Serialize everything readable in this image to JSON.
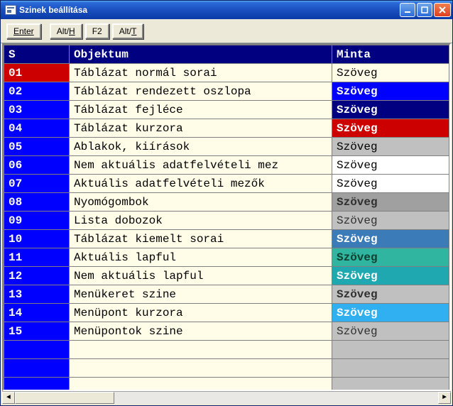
{
  "window": {
    "title": "Szinek beállítása"
  },
  "toolbar": {
    "enter": "Enter",
    "alth_pre": "Alt/",
    "alth_ul": "H",
    "f2": "F2",
    "altt_pre": "Alt/",
    "altt_ul": "T"
  },
  "columns": {
    "s": "S",
    "objektum": "Objektum",
    "minta": "Minta"
  },
  "rows": [
    {
      "s": "01",
      "obj": "Táblázat normál sorai",
      "minta": "Szöveg",
      "bg": "#fffde8",
      "fg": "#000000",
      "bold": false,
      "sel": true
    },
    {
      "s": "02",
      "obj": "Táblázat rendezett oszlopa",
      "minta": "Szöveg",
      "bg": "#0000ff",
      "fg": "#ffffff",
      "bold": true
    },
    {
      "s": "03",
      "obj": "Táblázat fejléce",
      "minta": "Szöveg",
      "bg": "#000080",
      "fg": "#ffffff",
      "bold": true
    },
    {
      "s": "04",
      "obj": "Táblázat kurzora",
      "minta": "Szöveg",
      "bg": "#cc0000",
      "fg": "#ffffff",
      "bold": true
    },
    {
      "s": "05",
      "obj": "Ablakok, kiírások",
      "minta": "Szöveg",
      "bg": "#c0c0c0",
      "fg": "#000000",
      "bold": false
    },
    {
      "s": "06",
      "obj": "Nem aktuális adatfelvételi mez",
      "minta": "Szöveg",
      "bg": "#ffffff",
      "fg": "#000000",
      "bold": false
    },
    {
      "s": "07",
      "obj": "Aktuális adatfelvételi mezők",
      "minta": "Szöveg",
      "bg": "#ffffff",
      "fg": "#000000",
      "bold": false
    },
    {
      "s": "08",
      "obj": "Nyomógombok",
      "minta": "Szöveg",
      "bg": "#a0a0a0",
      "fg": "#303030",
      "bold": true
    },
    {
      "s": "09",
      "obj": "Lista dobozok",
      "minta": "Szöveg",
      "bg": "#c0c0c0",
      "fg": "#303030",
      "bold": false
    },
    {
      "s": "10",
      "obj": "Táblázat kiemelt sorai",
      "minta": "Szöveg",
      "bg": "#3b7cb8",
      "fg": "#ffffff",
      "bold": true
    },
    {
      "s": "11",
      "obj": "Aktuális lapful",
      "minta": "Szöveg",
      "bg": "#2fb5a0",
      "fg": "#104030",
      "bold": true
    },
    {
      "s": "12",
      "obj": "Nem aktuális lapful",
      "minta": "Szöveg",
      "bg": "#20a8b0",
      "fg": "#ffffff",
      "bold": true
    },
    {
      "s": "13",
      "obj": "Menükeret szine",
      "minta": "Szöveg",
      "bg": "#c0c0c0",
      "fg": "#303030",
      "bold": true
    },
    {
      "s": "14",
      "obj": "Menüpont kurzora",
      "minta": "Szöveg",
      "bg": "#30b0f0",
      "fg": "#ffffff",
      "bold": true
    },
    {
      "s": "15",
      "obj": "Menüpontok szine",
      "minta": "Szöveg",
      "bg": "#c0c0c0",
      "fg": "#303030",
      "bold": false
    }
  ],
  "blank_rows": 3
}
